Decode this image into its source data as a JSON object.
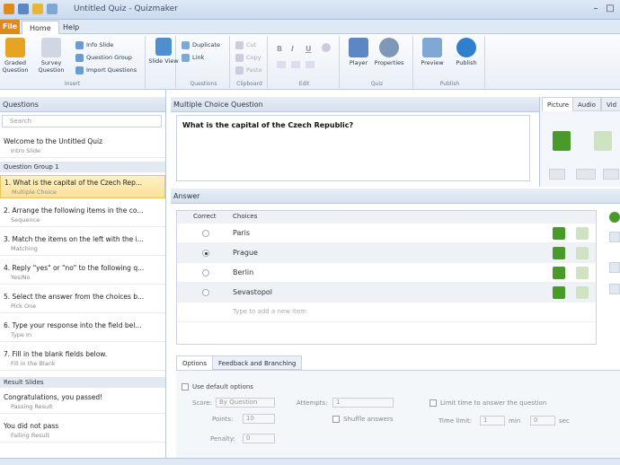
{
  "window": {
    "title": "Untitled Quiz - Quizmaker"
  },
  "ribbon_tabs": [
    "File",
    "Home",
    "Help"
  ],
  "ribbon": {
    "insert": {
      "graded": "Graded Question",
      "survey": "Survey Question",
      "info_slide": "Info Slide",
      "question_group": "Question Group",
      "import_questions": "Import Questions",
      "label": "Insert"
    },
    "slide_view": "Slide View",
    "questions": {
      "duplicate": "Duplicate",
      "link": "Link",
      "label": "Questions"
    },
    "clipboard": {
      "cut": "Cut",
      "copy": "Copy",
      "paste": "Paste",
      "label": "Clipboard"
    },
    "edit": {
      "label": "Edit"
    },
    "quiz": {
      "player": "Player",
      "properties": "Properties",
      "label": "Quiz"
    },
    "publish_group": {
      "preview": "Preview",
      "publish": "Publish",
      "label": "Publish"
    }
  },
  "left_pane": {
    "header": "Questions",
    "search_placeholder": "Search",
    "intro": {
      "title": "Welcome to the Untitled Quiz",
      "type": "Intro Slide"
    },
    "group_label": "Question Group 1",
    "questions": [
      {
        "title": "1. What is the capital of the Czech Rep...",
        "type": "Multiple Choice"
      },
      {
        "title": "2. Arrange the following items in the co...",
        "type": "Sequence"
      },
      {
        "title": "3. Match the items on the left with the i...",
        "type": "Matching"
      },
      {
        "title": "4. Reply \"yes\" or \"no\" to the following q...",
        "type": "Yes/No"
      },
      {
        "title": "5. Select the answer from the choices b...",
        "type": "Pick One"
      },
      {
        "title": "6. Type your response into the field bel...",
        "type": "Type In"
      },
      {
        "title": "7. Fill in the blank fields below.",
        "type": "Fill in the Blank"
      }
    ],
    "results_label": "Result Slides",
    "results": [
      {
        "title": "Congratulations, you passed!",
        "type": "Passing Result"
      },
      {
        "title": "You did not pass",
        "type": "Failing Result"
      }
    ]
  },
  "question_panel": {
    "header": "Multiple Choice Question",
    "question_text": "What is the capital of the Czech Republic?"
  },
  "media_tabs": [
    "Picture",
    "Audio",
    "Vid"
  ],
  "answer_panel": {
    "header": "Answer",
    "col_correct": "Correct",
    "col_choice": "Choices",
    "choices": [
      {
        "text": "Paris",
        "correct": false
      },
      {
        "text": "Prague",
        "correct": true
      },
      {
        "text": "Berlin",
        "correct": false
      },
      {
        "text": "Sevastopol",
        "correct": false
      }
    ],
    "add_placeholder": "Type to add a new item"
  },
  "bottom_tabs": [
    "Options",
    "Feedback and Branching"
  ],
  "options": {
    "use_default": "Use default options",
    "score_label": "Score:",
    "score_value": "By Question",
    "points_label": "Points:",
    "points_value": "10",
    "penalty_label": "Penalty:",
    "penalty_value": "0",
    "attempts_label": "Attempts:",
    "attempts_value": "1",
    "shuffle": "Shuffle answers",
    "limit_time": "Limit time to answer the question",
    "time_limit_label": "Time limit:",
    "min_value": "1",
    "min_label": "min",
    "sec_value": "0",
    "sec_label": "sec"
  },
  "colors": {
    "accent": "#e08a1e",
    "selection": "#fbe29a",
    "green_icon": "#4a9a2a"
  }
}
